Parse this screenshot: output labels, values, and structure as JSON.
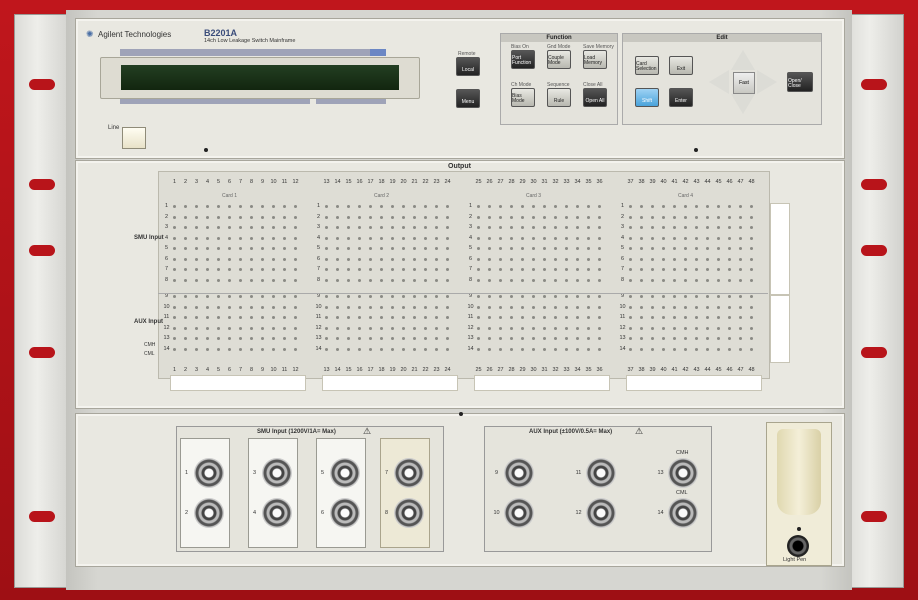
{
  "brand": "Agilent Technologies",
  "model": "B2201A",
  "subtitle": "14ch Low Leakage Switch Mainframe",
  "line_label": "Line",
  "remote_label": "Remote",
  "local_button": "Local",
  "menu_button": "Menu",
  "function_title": "Function",
  "function_buttons": [
    {
      "over": "Bias On",
      "label": "Port Function"
    },
    {
      "over": "Gnd Mode",
      "label": "Couple Mode"
    },
    {
      "over": "Save Memory",
      "label": "Load Memory"
    },
    {
      "over": "Ch Mode",
      "label": "Bias Mode"
    },
    {
      "over": "Sequence",
      "label": "Rule"
    },
    {
      "over": "Close All",
      "label": "Open All"
    }
  ],
  "edit_title": "Edit",
  "edit_buttons": [
    "Card Selection",
    "Exit",
    "Shift",
    "Enter"
  ],
  "nav_center": "Fast",
  "open_close": "Open/ Close",
  "output_title": "Output",
  "cards": [
    "Card 1",
    "Card 2",
    "Card 3",
    "Card 4"
  ],
  "row_groups": [
    "SMU Input",
    "AUX Input"
  ],
  "cmh_label": "CMH",
  "cml_label": "CML",
  "smu_input_title": "SMU Input (1200V/1A= Max)",
  "aux_input_title": "AUX Input (±100V/0.5A= Max)",
  "light_pen": "Light Pen",
  "colors": {
    "background": "#b8141a",
    "panel": "#e9e8e1",
    "display": "#1c3a1c",
    "shift": "#4aa3db"
  }
}
